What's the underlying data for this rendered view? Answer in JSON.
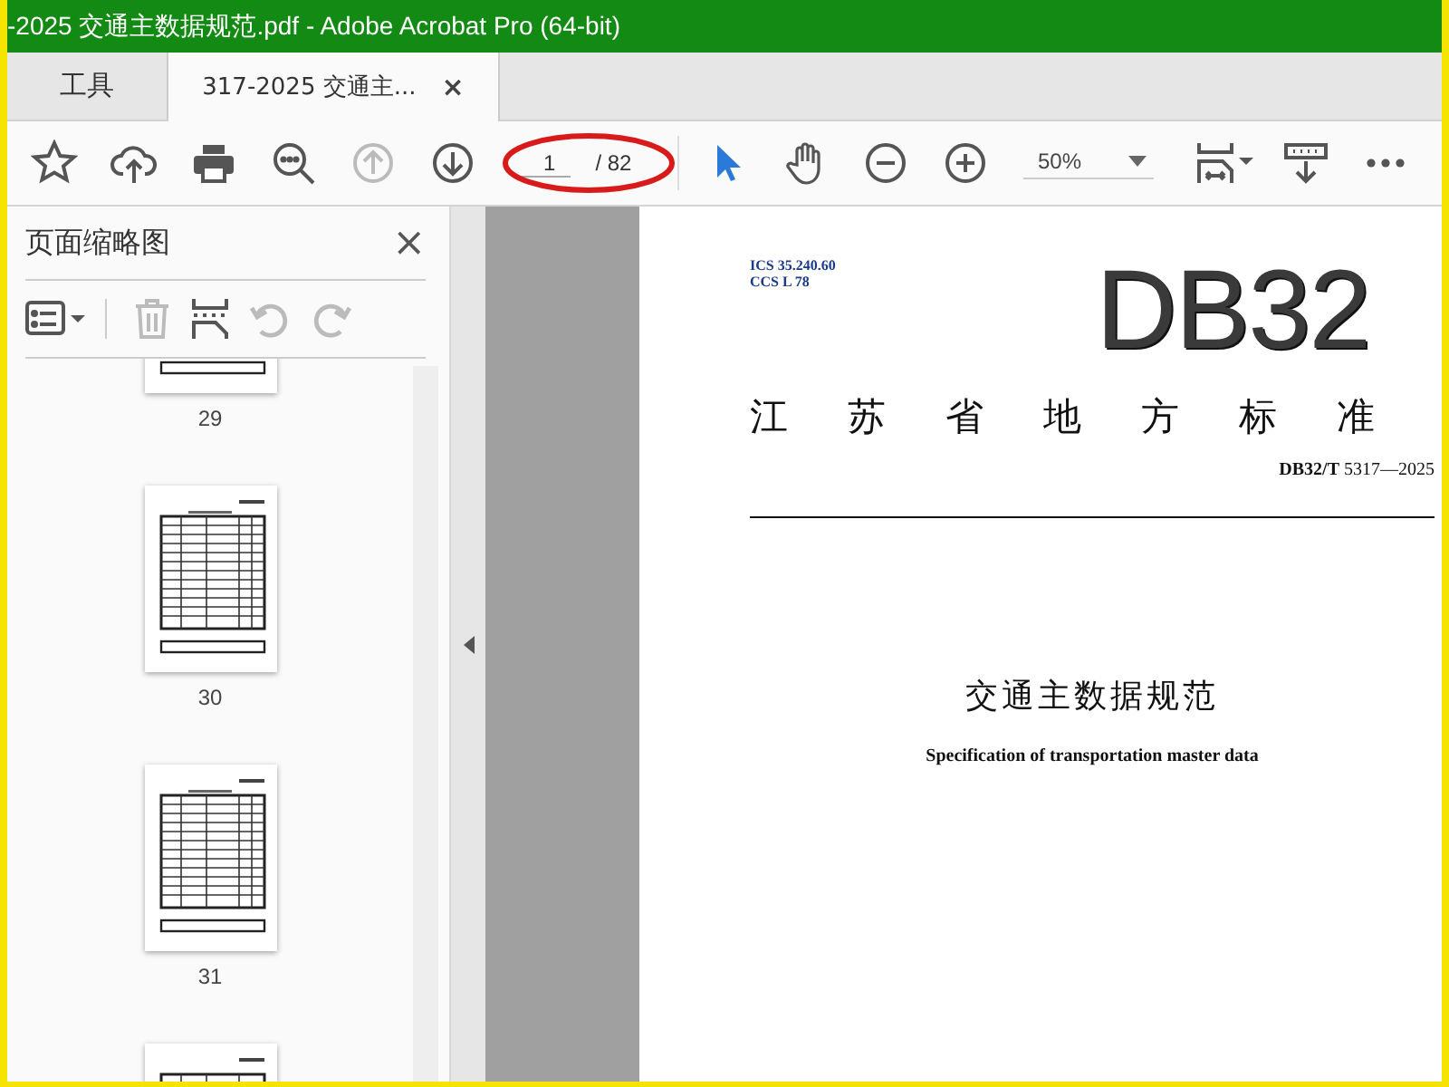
{
  "window": {
    "title": "-2025 交通主数据规范.pdf - Adobe Acrobat Pro (64-bit)"
  },
  "tabs": [
    {
      "label": "工具",
      "selected": false
    },
    {
      "label": "317-2025 交通主...",
      "selected": true,
      "close": "×"
    }
  ],
  "toolbar": {
    "tools_left": [
      {
        "kind": "star",
        "disabled": false
      },
      {
        "kind": "upload",
        "disabled": false
      },
      {
        "kind": "print",
        "disabled": false
      },
      {
        "kind": "find",
        "disabled": false
      },
      {
        "kind": "prev-page",
        "disabled": true
      },
      {
        "kind": "next-page",
        "disabled": false
      }
    ],
    "page_input": "1",
    "page_total": "/ 82",
    "tools_mid": [
      {
        "kind": "select",
        "selected": true
      },
      {
        "kind": "hand",
        "selected": false
      },
      {
        "kind": "zoom-out",
        "selected": false
      },
      {
        "kind": "zoom-in",
        "selected": false
      }
    ],
    "zoom": "50%",
    "tools_right": [
      {
        "kind": "fit"
      },
      {
        "kind": "measure"
      },
      {
        "kind": "more"
      }
    ]
  },
  "panel": {
    "title": "页面缩略图",
    "close": "×",
    "tools": [
      {
        "kind": "options",
        "disabled": false
      },
      {
        "kind": "delete",
        "disabled": true
      },
      {
        "kind": "insert",
        "disabled": false
      },
      {
        "kind": "rotate-left",
        "disabled": true
      },
      {
        "kind": "rotate-right",
        "disabled": true
      }
    ],
    "thumbnails": [
      {
        "label": "29"
      },
      {
        "label": "30"
      },
      {
        "label": "31"
      }
    ]
  },
  "document": {
    "ics": "ICS  35.240.60",
    "ccs": "CCS  L  78",
    "logo": "DB32",
    "heading": "江苏省地方标准",
    "standard_no": "**DB32/T** 5317—2025",
    "title": "交通主数据规范",
    "subtitle": "Specification of transportation master data"
  }
}
